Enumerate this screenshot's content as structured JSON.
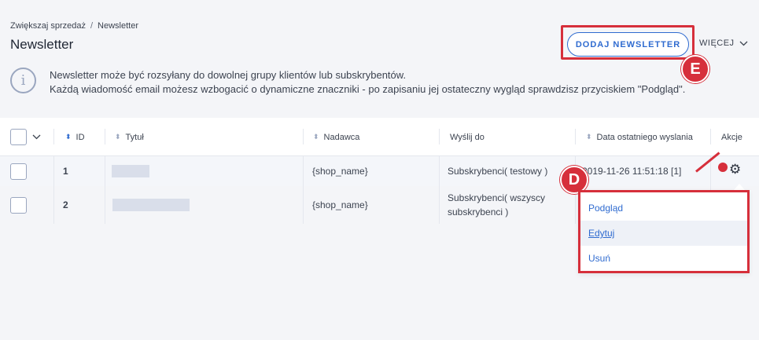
{
  "breadcrumb": {
    "parent": "Zwiększaj sprzedaż",
    "separator": "/",
    "current": "Newsletter"
  },
  "page_title": "Newsletter",
  "actions": {
    "add_label": "DODAJ NEWSLETTER",
    "more_label": "WIĘCEJ"
  },
  "info": {
    "line1": "Newsletter może być rozsyłany do dowolnej grupy klientów lub subskrybentów.",
    "line2": "Każdą wiadomość email możesz wzbogacić o dynamiczne znaczniki - po zapisaniu jej ostateczny wygląd sprawdzisz przyciskiem \"Podgląd\"."
  },
  "markers": {
    "e": "E",
    "d": "D"
  },
  "table": {
    "columns": {
      "id": "ID",
      "title": "Tytuł",
      "sender": "Nadawca",
      "send_to": "Wyślij do",
      "last_sent": "Data ostatniego wyslania",
      "actions": "Akcje"
    },
    "rows": [
      {
        "id": "1",
        "sender": "{shop_name}",
        "send_to": "Subskrybenci( testowy )",
        "last_sent": "2019-11-26 11:51:18 [1]"
      },
      {
        "id": "2",
        "sender": "{shop_name}",
        "send_to_l1": "Subskrybenci( wszyscy",
        "send_to_l2": "subskrybenci )"
      }
    ]
  },
  "dropdown": {
    "items": [
      "Podgląd",
      "Edytuj",
      "Usuń"
    ],
    "hovered": "Edytuj"
  },
  "colors": {
    "accent": "#2f6bd0",
    "highlight": "#d62f3b",
    "background": "#f4f5f8"
  }
}
